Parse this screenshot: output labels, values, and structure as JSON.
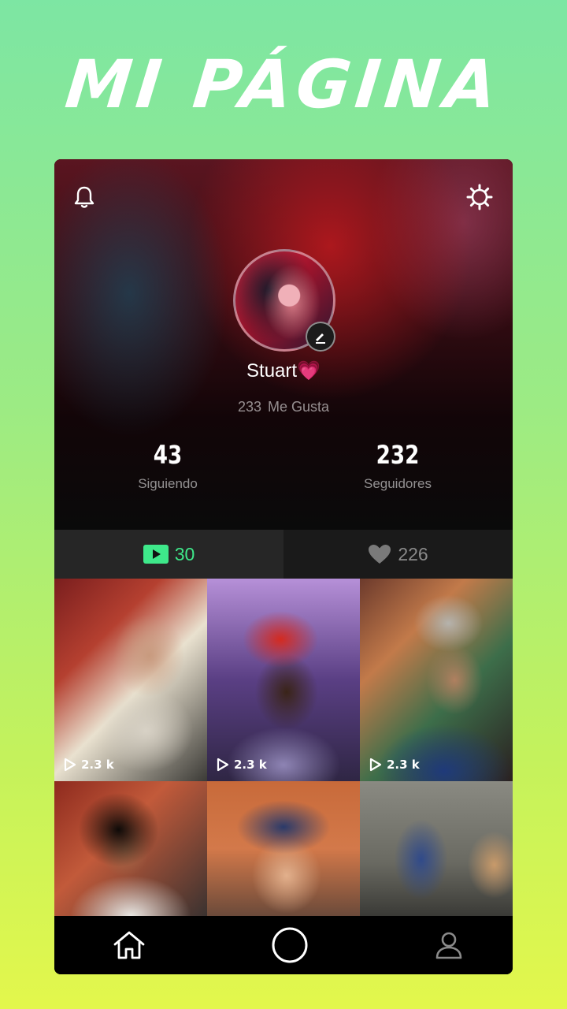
{
  "headline": "MI PÁGINA",
  "profile": {
    "username": "Stuart",
    "username_emoji": "💗",
    "likes_count": "233",
    "likes_label": "Me Gusta",
    "following_count": "43",
    "following_label": "Siguiendo",
    "followers_count": "232",
    "followers_label": "Seguidores"
  },
  "tabs": {
    "videos_count": "30",
    "liked_count": "226"
  },
  "videos": [
    {
      "plays": "2.3 k"
    },
    {
      "plays": "2.3 k"
    },
    {
      "plays": "2.3 k"
    },
    {
      "plays": ""
    },
    {
      "plays": ""
    },
    {
      "plays": ""
    }
  ],
  "colors": {
    "accent": "#3ee88a",
    "tab_active_bg": "#262626",
    "tab_inactive_bg": "#1a1a1a",
    "navbar_bg": "#000000"
  },
  "icons": {
    "top_left": "bell-icon",
    "top_right": "gear-icon",
    "avatar_badge": "pencil-icon",
    "videos_tab": "play-icon",
    "liked_tab": "heart-icon",
    "nav": [
      "home-icon",
      "record-icon",
      "profile-icon"
    ]
  }
}
